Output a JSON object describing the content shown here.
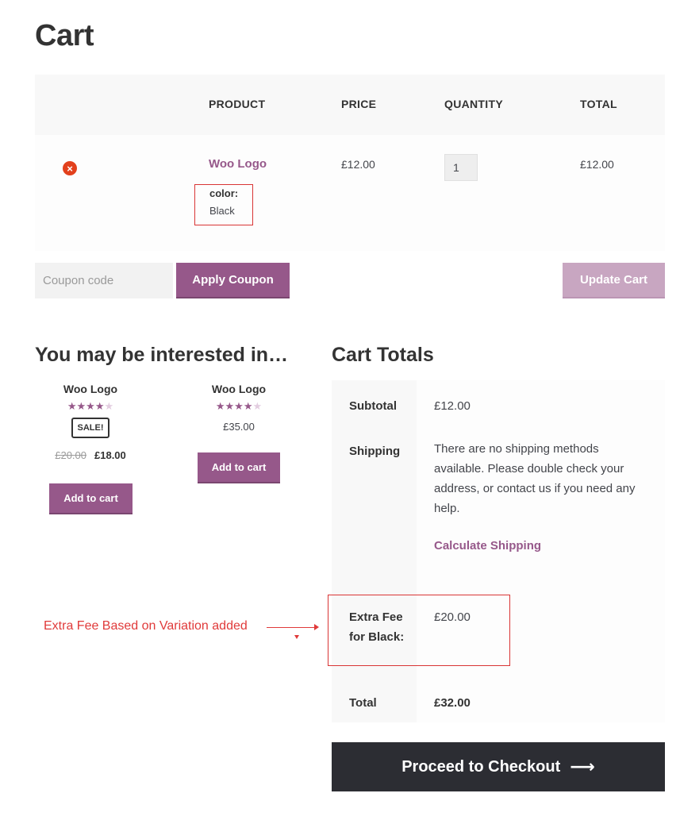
{
  "page": {
    "title": "Cart"
  },
  "cart_table": {
    "headers": {
      "product": "PRODUCT",
      "price": "PRICE",
      "quantity": "QUANTITY",
      "total": "TOTAL"
    },
    "items": [
      {
        "name": "Woo Logo",
        "variation_key": "color:",
        "variation_value": "Black",
        "price": "£12.00",
        "quantity": "1",
        "total": "£12.00",
        "remove_icon": "×"
      }
    ]
  },
  "coupon": {
    "placeholder": "Coupon code",
    "apply_label": "Apply Coupon",
    "update_label": "Update Cart"
  },
  "cross_sells": {
    "heading": "You may be interested in…",
    "products": [
      {
        "title": "Woo Logo",
        "rating_full": "★★★★",
        "rating_empty": "★",
        "sale_badge": "SALE!",
        "old_price": "£20.00",
        "price": "£18.00",
        "button": "Add to cart"
      },
      {
        "title": "Woo Logo",
        "rating_full": "★★★★",
        "rating_empty": "★",
        "price": "£35.00",
        "button": "Add to cart"
      }
    ]
  },
  "cart_totals": {
    "heading": "Cart Totals",
    "subtotal_label": "Subtotal",
    "subtotal_value": "£12.00",
    "shipping_label": "Shipping",
    "shipping_text": "There are no shipping methods available. Please double check your address, or contact us if you need any help.",
    "calculate_shipping": "Calculate Shipping",
    "fee_label": "Extra Fee for Black:",
    "fee_value": "£20.00",
    "total_label": "Total",
    "total_value": "£32.00"
  },
  "annotation": {
    "text": "Extra Fee Based on Variation added",
    "color": "#e03a3a"
  },
  "checkout": {
    "label": "Proceed to Checkout",
    "arrow_icon": "⟶"
  },
  "colors": {
    "accent": "#96588a",
    "accent_disabled": "#c8a6c1",
    "checkout_bg": "#2c2d33",
    "remove_icon": "#e2401c"
  }
}
